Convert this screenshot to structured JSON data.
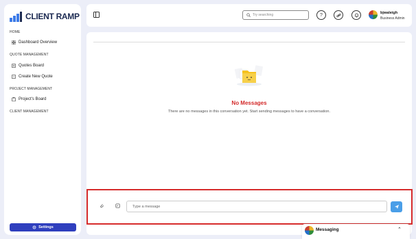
{
  "brand": {
    "name": "CLIENT RAMP",
    "accent": "#3d7be8"
  },
  "sidebar": {
    "sections": [
      {
        "label": "HOME"
      },
      {
        "label": "QUOTE MANAGEMENT"
      },
      {
        "label": "PROJECT MANAGEMENT"
      },
      {
        "label": "CLIENT MANAGEMENT"
      }
    ],
    "items": [
      {
        "label": "Dashboard Overview",
        "icon": "grid-icon"
      },
      {
        "label": "Quotes Board",
        "icon": "document-icon"
      },
      {
        "label": "Create New Quote",
        "icon": "document-add-icon"
      },
      {
        "label": "Project's Board",
        "icon": "clipboard-icon"
      }
    ],
    "settings_label": "Settings",
    "settings_color": "#2f3fbe"
  },
  "topbar": {
    "search_placeholder": "Try searching",
    "user": {
      "name": "bjwaleigh",
      "role": "Business Admin"
    }
  },
  "main": {
    "empty_title": "No Messages",
    "empty_description": "There are no messages in this conversation yet. Start sending messages to have a conversation.",
    "empty_title_color": "#d32a2a"
  },
  "composer": {
    "placeholder": "Type a message",
    "send_color": "#4a9ee8",
    "highlight_color": "#d62b2b"
  },
  "messaging_tab": {
    "label": "Messaging"
  }
}
